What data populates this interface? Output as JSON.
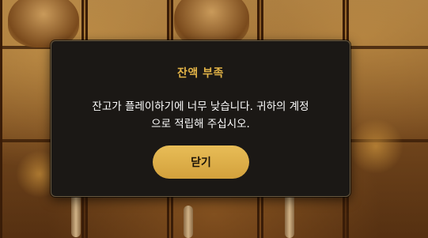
{
  "dialog": {
    "title": "잔액 부족",
    "message_line1": "잔고가 플레이하기에 너무 낮습니다. 귀하의 계정",
    "message_line2": "으로 적립해 주십시오.",
    "close_label": "닫기"
  },
  "colors": {
    "accent": "#e2b347",
    "button": "#dcae4a",
    "dialog_bg": "#1b1815",
    "text": "#ffffff"
  }
}
